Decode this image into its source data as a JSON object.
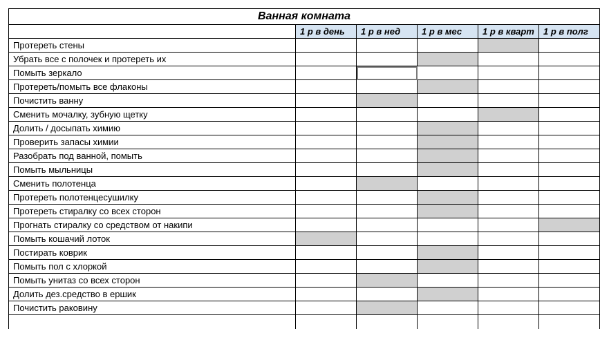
{
  "title": "Ванная комната",
  "columns": [
    "1 р в день",
    "1 р в нед",
    "1 р в мес",
    "1 р в кварт",
    "1 р в полг"
  ],
  "rows": [
    {
      "task": "Протереть стены",
      "marks": [
        "",
        "",
        "",
        "shaded",
        ""
      ]
    },
    {
      "task": "Убрать все с полочек и протереть их",
      "marks": [
        "",
        "",
        "shaded",
        "",
        ""
      ]
    },
    {
      "task": "Помыть зеркало",
      "marks": [
        "",
        "selected",
        "",
        "",
        ""
      ]
    },
    {
      "task": "Протереть/помыть все флаконы",
      "marks": [
        "",
        "",
        "shaded",
        "",
        ""
      ]
    },
    {
      "task": "Почистить ванну",
      "marks": [
        "",
        "shaded",
        "",
        "",
        ""
      ]
    },
    {
      "task": "Сменить мочалку, зубную щетку",
      "marks": [
        "",
        "",
        "",
        "shaded",
        ""
      ]
    },
    {
      "task": "Долить / досыпать химию",
      "marks": [
        "",
        "",
        "shaded",
        "",
        ""
      ]
    },
    {
      "task": "Проверить запасы химии",
      "marks": [
        "",
        "",
        "shaded",
        "",
        ""
      ]
    },
    {
      "task": "Разобрать под ванной, помыть",
      "marks": [
        "",
        "",
        "shaded",
        "",
        ""
      ]
    },
    {
      "task": "Помыть мыльницы",
      "marks": [
        "",
        "",
        "shaded",
        "",
        ""
      ]
    },
    {
      "task": "Сменить полотенца",
      "marks": [
        "",
        "shaded",
        "",
        "",
        ""
      ]
    },
    {
      "task": "Протереть полотенцесушилку",
      "marks": [
        "",
        "",
        "shaded",
        "",
        ""
      ]
    },
    {
      "task": "Протереть стиралку со всех сторон",
      "marks": [
        "",
        "",
        "shaded",
        "",
        ""
      ]
    },
    {
      "task": "Прогнать стиралку со средством от накипи",
      "marks": [
        "",
        "",
        "",
        "",
        "shaded"
      ]
    },
    {
      "task": "Помыть кошачий лоток",
      "marks": [
        "shaded",
        "",
        "",
        "",
        ""
      ]
    },
    {
      "task": "Постирать коврик",
      "marks": [
        "",
        "",
        "shaded",
        "",
        ""
      ]
    },
    {
      "task": "Помыть пол с хлоркой",
      "marks": [
        "",
        "",
        "shaded",
        "",
        ""
      ]
    },
    {
      "task": "Помыть унитаз со всех сторон",
      "marks": [
        "",
        "shaded",
        "",
        "",
        ""
      ]
    },
    {
      "task": "Долить дез.средство в ершик",
      "marks": [
        "",
        "",
        "shaded",
        "",
        ""
      ]
    },
    {
      "task": "Почистить раковину",
      "marks": [
        "",
        "shaded",
        "",
        "",
        ""
      ]
    }
  ]
}
